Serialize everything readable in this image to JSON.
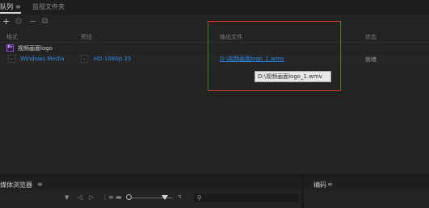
{
  "tabs": {
    "queue": "队列",
    "queue_menu": "≡",
    "watch_folders": "监视文件夹"
  },
  "toolbar": {
    "add_glyph": "+",
    "settings_glyph": "⚙",
    "remove_glyph": "−",
    "duplicate_glyph": "⧉"
  },
  "queue": {
    "columns": {
      "format": "格式",
      "preset": "预设",
      "output": "输出文件",
      "status": "状态"
    },
    "job": {
      "icon_text": "Pr",
      "name": "视频画面logo"
    },
    "item": {
      "format": "Windows Media",
      "preset": "HD 1080p 25",
      "output": "D:\\视频画面logo_1.wmv",
      "status": "就绪",
      "chevron": "⌄"
    },
    "tooltip": "D:\\视频画面logo_1.wmv"
  },
  "media_browser": {
    "title": "媒体浏览器",
    "menu": "≡",
    "funnel": "▼",
    "back": "◁",
    "forward": "▷",
    "list_view": "⋮≡",
    "thumb_view": "▬",
    "sort": "⇅",
    "search_glyph": "⚲"
  },
  "encode": {
    "title": "编码",
    "menu": "≡"
  },
  "colors": {
    "background": "#232323",
    "link": "#2d8ceb",
    "highlight": "#cf3b2a"
  }
}
